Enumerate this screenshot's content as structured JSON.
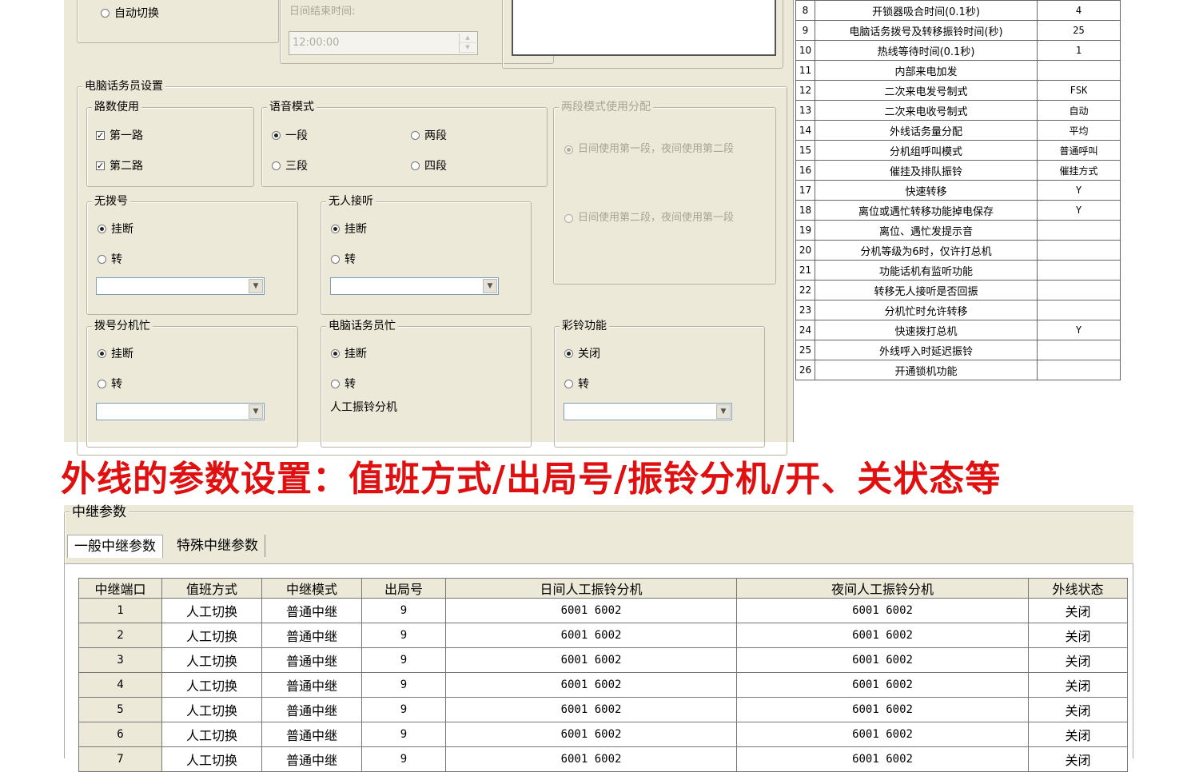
{
  "top_left": {
    "auto_switch": "自动切换",
    "day_end_label": "日间结束时间:",
    "day_end_value": "12:00:00",
    "operator_group": "电脑话务员设置",
    "lines_group": "路数使用",
    "line1": "第一路",
    "line2": "第二路",
    "voice_group": "语音模式",
    "voice_options": [
      "一段",
      "两段",
      "三段",
      "四段"
    ],
    "two_stage_group": "两段模式使用分配",
    "two_stage_opt1": "日间使用第一段，夜间使用第二段",
    "two_stage_opt2": "日间使用第二段，夜间使用第一段",
    "no_dial_group": "无拨号",
    "no_answer_group": "无人接听",
    "busy_ext_group": "拨号分机忙",
    "op_busy_group": "电脑话务员忙",
    "ringback_group": "彩铃功能",
    "hangup": "挂断",
    "transfer": "转",
    "close": "关闭",
    "manual_ring_ext": "人工振铃分机"
  },
  "right_table": [
    {
      "n": "8",
      "name": "开锁器吸合时间(0.1秒)",
      "v": "4"
    },
    {
      "n": "9",
      "name": "电脑话务拨号及转移振铃时间(秒)",
      "v": "25"
    },
    {
      "n": "10",
      "name": "热线等待时间(0.1秒)",
      "v": "1"
    },
    {
      "n": "11",
      "name": "内部来电加发",
      "v": ""
    },
    {
      "n": "12",
      "name": "二次来电发号制式",
      "v": "FSK"
    },
    {
      "n": "13",
      "name": "二次来电收号制式",
      "v": "自动"
    },
    {
      "n": "14",
      "name": "外线话务量分配",
      "v": "平均"
    },
    {
      "n": "15",
      "name": "分机组呼叫模式",
      "v": "普通呼叫"
    },
    {
      "n": "16",
      "name": "催挂及排队振铃",
      "v": "催挂方式"
    },
    {
      "n": "17",
      "name": "快速转移",
      "v": "Y"
    },
    {
      "n": "18",
      "name": "离位或遇忙转移功能掉电保存",
      "v": "Y"
    },
    {
      "n": "19",
      "name": "离位、遇忙发提示音",
      "v": ""
    },
    {
      "n": "20",
      "name": "分机等级为6时，仅许打总机",
      "v": ""
    },
    {
      "n": "21",
      "name": "功能话机有监听功能",
      "v": ""
    },
    {
      "n": "22",
      "name": "转移无人接听是否回振",
      "v": ""
    },
    {
      "n": "23",
      "name": "分机忙时允许转移",
      "v": ""
    },
    {
      "n": "24",
      "name": "快速拨打总机",
      "v": "Y"
    },
    {
      "n": "25",
      "name": "外线呼入时延迟振铃",
      "v": ""
    },
    {
      "n": "26",
      "name": "开通锁机功能",
      "v": ""
    }
  ],
  "heading": "外线的参数设置：值班方式/出局号/振铃分机/开、关状态等",
  "bottom": {
    "group_title": "中继参数",
    "tab_general": "一般中继参数",
    "tab_special": "特殊中继参数",
    "columns": [
      "中继端口",
      "值班方式",
      "中继模式",
      "出局号",
      "日间人工振铃分机",
      "夜间人工振铃分机",
      "外线状态"
    ],
    "rows": [
      [
        "1",
        "人工切换",
        "普通中继",
        "9",
        "6001  6002",
        "6001  6002",
        "关闭"
      ],
      [
        "2",
        "人工切换",
        "普通中继",
        "9",
        "6001  6002",
        "6001  6002",
        "关闭"
      ],
      [
        "3",
        "人工切换",
        "普通中继",
        "9",
        "6001  6002",
        "6001  6002",
        "关闭"
      ],
      [
        "4",
        "人工切换",
        "普通中继",
        "9",
        "6001  6002",
        "6001  6002",
        "关闭"
      ],
      [
        "5",
        "人工切换",
        "普通中继",
        "9",
        "6001  6002",
        "6001  6002",
        "关闭"
      ],
      [
        "6",
        "人工切换",
        "普通中继",
        "9",
        "6001  6002",
        "6001  6002",
        "关闭"
      ],
      [
        "7",
        "人工切换",
        "普通中继",
        "9",
        "6001  6002",
        "6001  6002",
        "关闭"
      ]
    ]
  }
}
